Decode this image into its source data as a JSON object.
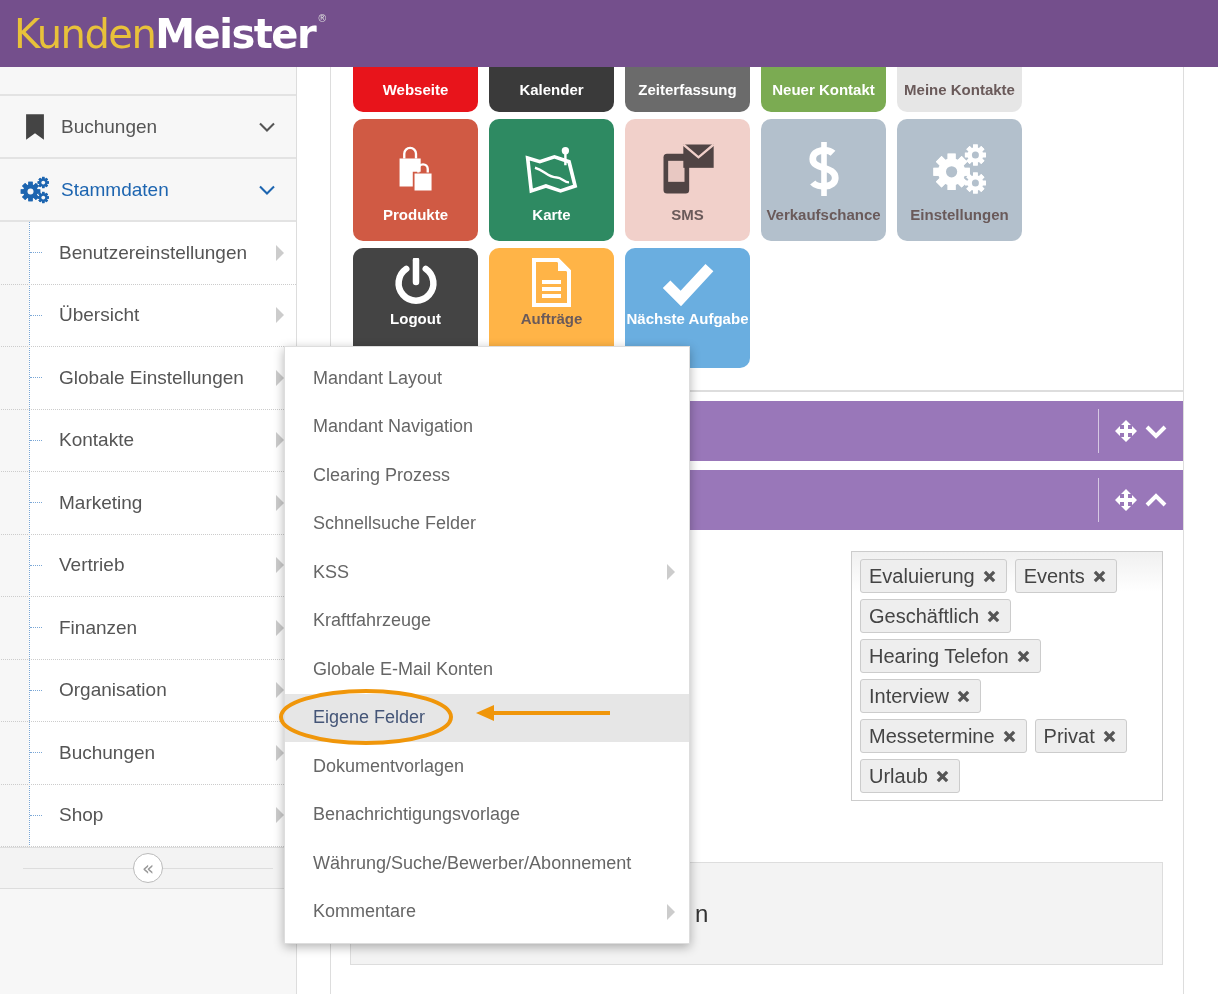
{
  "header": {
    "logo": {
      "first": "Kunden",
      "second": "Meister",
      "mark": "®"
    }
  },
  "sidebar": {
    "items": [
      {
        "label": "Buchungen",
        "expanded": false
      },
      {
        "label": "Stammdaten",
        "expanded": true,
        "children": [
          {
            "label": "Benutzereinstellungen"
          },
          {
            "label": "Übersicht"
          },
          {
            "label": "Globale Einstellungen"
          },
          {
            "label": "Kontakte"
          },
          {
            "label": "Marketing"
          },
          {
            "label": "Vertrieb"
          },
          {
            "label": "Finanzen"
          },
          {
            "label": "Organisation"
          },
          {
            "label": "Buchungen"
          },
          {
            "label": "Shop"
          }
        ]
      }
    ],
    "collapse_button": "«"
  },
  "tiles": [
    {
      "label": "Webseite",
      "color": "#e8141b"
    },
    {
      "label": "Kalender",
      "color": "#3a3a3a"
    },
    {
      "label": "Zeiterfassung",
      "color": "#6b6b6b"
    },
    {
      "label": "Neuer Kontakt",
      "color": "#7bab52"
    },
    {
      "label": "Meine Kontakte",
      "color": "#e6e6e6"
    },
    {
      "label": "Produkte",
      "color": "#d05a44"
    },
    {
      "label": "Karte",
      "color": "#2e8a62"
    },
    {
      "label": "SMS",
      "color": "#f1d0ca"
    },
    {
      "label": "Verkaufschance",
      "color": "#b3c0cc"
    },
    {
      "label": "Einstellungen",
      "color": "#b3c0cc"
    },
    {
      "label": "Logout",
      "color": "#444444"
    },
    {
      "label": "Aufträge",
      "color": "#ffb447"
    },
    {
      "label": "Nächste Aufgabe",
      "color": "#6aaee0"
    }
  ],
  "panels": [
    {
      "expanded": false
    },
    {
      "expanded": true,
      "tags": [
        "Evaluierung",
        "Events",
        "Geschäftlich",
        "Hearing Telefon",
        "Interview",
        "Messetermine",
        "Privat",
        "Urlaub"
      ]
    },
    {
      "title": "n"
    }
  ],
  "menu": {
    "items": [
      {
        "label": "Mandant Layout",
        "submenu": false,
        "selected": false
      },
      {
        "label": "Mandant Navigation",
        "submenu": false,
        "selected": false
      },
      {
        "label": "Clearing Prozess",
        "submenu": false,
        "selected": false
      },
      {
        "label": "Schnellsuche Felder",
        "submenu": false,
        "selected": false
      },
      {
        "label": "KSS",
        "submenu": true,
        "selected": false
      },
      {
        "label": "Kraftfahrzeuge",
        "submenu": false,
        "selected": false
      },
      {
        "label": "Globale E-Mail Konten",
        "submenu": false,
        "selected": false
      },
      {
        "label": "Eigene Felder",
        "submenu": false,
        "selected": true
      },
      {
        "label": "Dokumentvorlagen",
        "submenu": false,
        "selected": false
      },
      {
        "label": "Benachrichtigungsvorlage",
        "submenu": false,
        "selected": false
      },
      {
        "label": "Währung/Suche/Bewerber/Abonnement",
        "submenu": false,
        "selected": false
      },
      {
        "label": "Kommentare",
        "submenu": true,
        "selected": false
      }
    ]
  }
}
